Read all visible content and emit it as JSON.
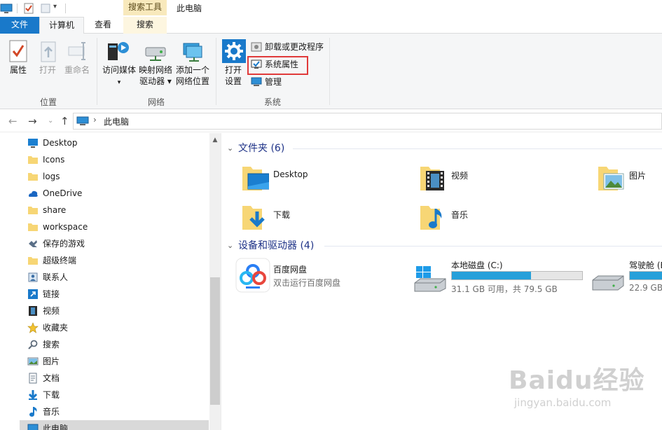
{
  "titlebar": {
    "context_tab_header": "搜索工具",
    "title": "此电脑"
  },
  "tabs": [
    {
      "label": "文件"
    },
    {
      "label": "计算机"
    },
    {
      "label": "查看"
    },
    {
      "label": "搜索"
    }
  ],
  "ribbon": {
    "location_group": {
      "label": "位置",
      "buttons": [
        {
          "label": "属性",
          "disabled": false
        },
        {
          "label": "打开",
          "disabled": true
        },
        {
          "label": "重命名",
          "disabled": true
        }
      ]
    },
    "network_group": {
      "label": "网络",
      "buttons": [
        {
          "line1": "访问媒体",
          "line2": "▾"
        },
        {
          "line1": "映射网络",
          "line2": "驱动器 ▾"
        },
        {
          "line1": "添加一个",
          "line2": "网络位置"
        }
      ]
    },
    "system_group": {
      "label": "系统",
      "open_settings": {
        "line1": "打开",
        "line2": "设置"
      },
      "small_buttons": [
        {
          "label": "卸载或更改程序"
        },
        {
          "label": "系统属性"
        },
        {
          "label": "管理"
        }
      ]
    }
  },
  "address": {
    "separator": "›",
    "crumb": "此电脑"
  },
  "sidebar": {
    "items": [
      {
        "label": "Desktop",
        "icon": "desktop-icon"
      },
      {
        "label": "Icons",
        "icon": "folder-icon"
      },
      {
        "label": "logs",
        "icon": "folder-icon"
      },
      {
        "label": "OneDrive",
        "icon": "onedrive-icon"
      },
      {
        "label": "share",
        "icon": "folder-icon"
      },
      {
        "label": "workspace",
        "icon": "folder-icon"
      },
      {
        "label": "保存的游戏",
        "icon": "saved-games-icon"
      },
      {
        "label": "超级终端",
        "icon": "folder-icon"
      },
      {
        "label": "联系人",
        "icon": "contacts-icon"
      },
      {
        "label": "链接",
        "icon": "links-icon"
      },
      {
        "label": "视频",
        "icon": "videos-icon"
      },
      {
        "label": "收藏夹",
        "icon": "favorites-icon"
      },
      {
        "label": "搜索",
        "icon": "search-icon"
      },
      {
        "label": "图片",
        "icon": "pictures-icon"
      },
      {
        "label": "文档",
        "icon": "documents-icon"
      },
      {
        "label": "下载",
        "icon": "downloads-icon"
      },
      {
        "label": "音乐",
        "icon": "music-icon"
      },
      {
        "label": "此电脑",
        "icon": "this-pc-icon"
      }
    ]
  },
  "content": {
    "folders_header": "文件夹 (6)",
    "folders": [
      {
        "label": "Desktop",
        "icon": "desktop-folder-icon"
      },
      {
        "label": "视频",
        "icon": "videos-folder-icon"
      },
      {
        "label": "图片",
        "icon": "pictures-folder-icon"
      },
      {
        "label": "下载",
        "icon": "downloads-folder-icon"
      },
      {
        "label": "音乐",
        "icon": "music-folder-icon"
      }
    ],
    "devices_header": "设备和驱动器 (4)",
    "devices": [
      {
        "name": "百度网盘",
        "sub": "双击运行百度网盘",
        "icon": "baidu-netdisk-icon"
      },
      {
        "name": "本地磁盘 (C:)",
        "sub": "31.1 GB 可用，共 79.5 GB",
        "used_fraction": 0.61,
        "icon": "windows-drive-icon"
      },
      {
        "name": "驾驶舱 (E",
        "sub": "22.9 GB",
        "used_fraction": 0.9,
        "icon": "hard-drive-icon"
      }
    ]
  },
  "watermark": {
    "line1": "Baidu经验",
    "line2": "jingyan.baidu.com"
  },
  "colors": {
    "accent": "#1979ca",
    "drive_bar": "#26a0da",
    "highlight": "#e03a3a",
    "section_header": "#1e3287"
  }
}
